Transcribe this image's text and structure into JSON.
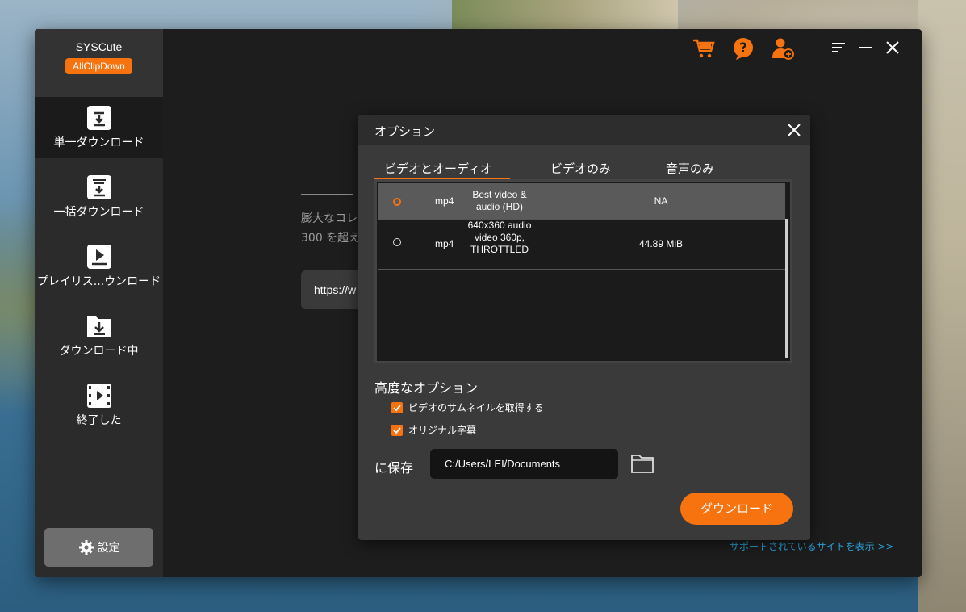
{
  "app": {
    "name": "SYSCute",
    "badge": "AllClipDown"
  },
  "sidebar": {
    "items": [
      {
        "label": "単一ダウンロード",
        "icon": "download-box-icon",
        "active": true
      },
      {
        "label": "一括ダウンロード",
        "icon": "batch-download-icon",
        "active": false
      },
      {
        "label": "プレイリス...ウンロード",
        "icon": "playlist-icon",
        "active": false
      },
      {
        "label": "ダウンロード中",
        "icon": "downloading-folder-icon",
        "active": false
      },
      {
        "label": "終了した",
        "icon": "film-icon",
        "active": false
      }
    ],
    "settings_label": "設定"
  },
  "background": {
    "text_line1": "膨大なコレ",
    "text_line2": "300 を超え",
    "url_value": "https://w",
    "support_link": "サポートされているサイトを表示 >>"
  },
  "dialog": {
    "title": "オプション",
    "tabs": [
      "ビデオとオーディオ",
      "ビデオのみ",
      "音声のみ"
    ],
    "active_tab": 0,
    "formats": [
      {
        "ext": "mp4",
        "desc": "Best video & audio (HD)",
        "size": "NA",
        "selected": true
      },
      {
        "ext": "mp4",
        "desc": "640x360 audio video 360p, THROTTLED",
        "size": "44.89 MiB",
        "selected": false
      }
    ],
    "advanced_title": "高度なオプション",
    "options": [
      {
        "label": "ビデオのサムネイルを取得する",
        "checked": true
      },
      {
        "label": "オリジナル字幕",
        "checked": true
      }
    ],
    "save_label": "に保存",
    "save_path": "C:/Users/LEI/Documents",
    "download_button": "ダウンロード"
  },
  "colors": {
    "accent": "#f7730f",
    "window_bg": "#1d1d1d",
    "sidebar_bg": "#2b2b2b",
    "link": "#2aa0d6"
  }
}
